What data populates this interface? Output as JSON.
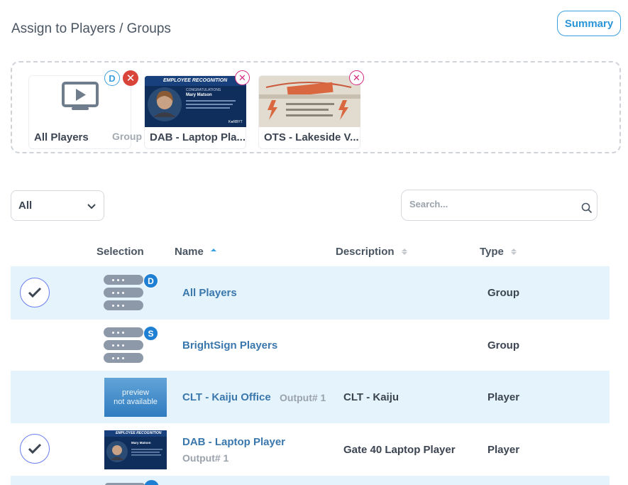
{
  "header": {
    "title": "Assign to Players / Groups",
    "summary_label": "Summary"
  },
  "assigned": [
    {
      "label": "All Players",
      "tag": "Group",
      "badge": "D"
    },
    {
      "label": "DAB - Laptop Pla...",
      "thumb_title": "EMPLOYEE RECOGNITION",
      "thumb_sub": "CONGRATULATIONS",
      "thumb_name": "Mary Matson",
      "thumb_brand": "K●RBYT"
    },
    {
      "label": "OTS - Lakeside V..."
    }
  ],
  "filter": {
    "selected": "All"
  },
  "search": {
    "placeholder": "Search..."
  },
  "table": {
    "headers": {
      "selection": "Selection",
      "name": "Name",
      "description": "Description",
      "type": "Type"
    },
    "rows": [
      {
        "name": "All Players",
        "type": "Group",
        "badge": "D",
        "selected": true
      },
      {
        "name": "BrightSign Players",
        "type": "Group",
        "badge": "S",
        "selected": false
      },
      {
        "name": "CLT - Kaiju Office",
        "output": "Output# 1",
        "description": "CLT - Kaiju",
        "type": "Player",
        "preview_line1": "preview",
        "preview_line2": "not available",
        "selected": false
      },
      {
        "name": "DAB - Laptop Player",
        "output": "Output# 1",
        "description": "Gate 40 Laptop Player",
        "type": "Player",
        "thumb_title": "EMPLOYEE RECOGNITION",
        "thumb_name": "Mary Matson",
        "selected": true
      }
    ]
  },
  "colors": {
    "accent": "#3aa1e0",
    "row_highlight": "#e4f3fc",
    "remove_red": "#d9443a",
    "remove_pink": "#d62a7f",
    "link": "#3a77ac"
  }
}
